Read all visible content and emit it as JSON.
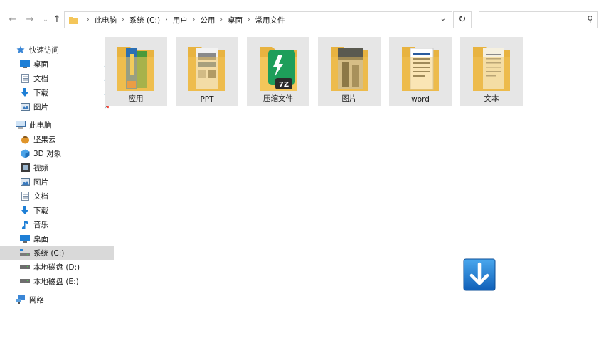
{
  "address_bar": {
    "breadcrumbs": [
      "此电脑",
      "系统 (C:)",
      "用户",
      "公用",
      "桌面",
      "常用文件"
    ]
  },
  "sidebar": {
    "quick_access_label": "快速访问",
    "quick_access_items": [
      {
        "label": "桌面",
        "icon": "desktop-icon"
      },
      {
        "label": "文档",
        "icon": "document-icon"
      },
      {
        "label": "下载",
        "icon": "download-arrow-icon"
      },
      {
        "label": "图片",
        "icon": "picture-icon"
      }
    ],
    "this_pc_label": "此电脑",
    "this_pc_items": [
      {
        "label": "坚果云",
        "icon": "nutstore-icon"
      },
      {
        "label": "3D 对象",
        "icon": "cube-3d-icon"
      },
      {
        "label": "视频",
        "icon": "video-icon"
      },
      {
        "label": "图片",
        "icon": "picture-icon"
      },
      {
        "label": "文档",
        "icon": "document-icon"
      },
      {
        "label": "下载",
        "icon": "download-arrow-icon"
      },
      {
        "label": "音乐",
        "icon": "music-note-icon"
      },
      {
        "label": "桌面",
        "icon": "desktop-icon"
      },
      {
        "label": "系统 (C:)",
        "icon": "system-drive-icon",
        "selected": true
      },
      {
        "label": "本地磁盘 (D:)",
        "icon": "drive-icon"
      },
      {
        "label": "本地磁盘 (E:)",
        "icon": "drive-icon"
      }
    ],
    "network_label": "网络"
  },
  "folders": [
    {
      "label": "应用"
    },
    {
      "label": "PPT"
    },
    {
      "label": "压缩文件"
    },
    {
      "label": "图片"
    },
    {
      "label": "word"
    },
    {
      "label": "文本"
    }
  ],
  "archive_badge_text": "7Z",
  "colors": {
    "folder": "#f4c65a",
    "selected_bg": "#d9d9d9",
    "accent_blue": "#1e7fd6"
  }
}
